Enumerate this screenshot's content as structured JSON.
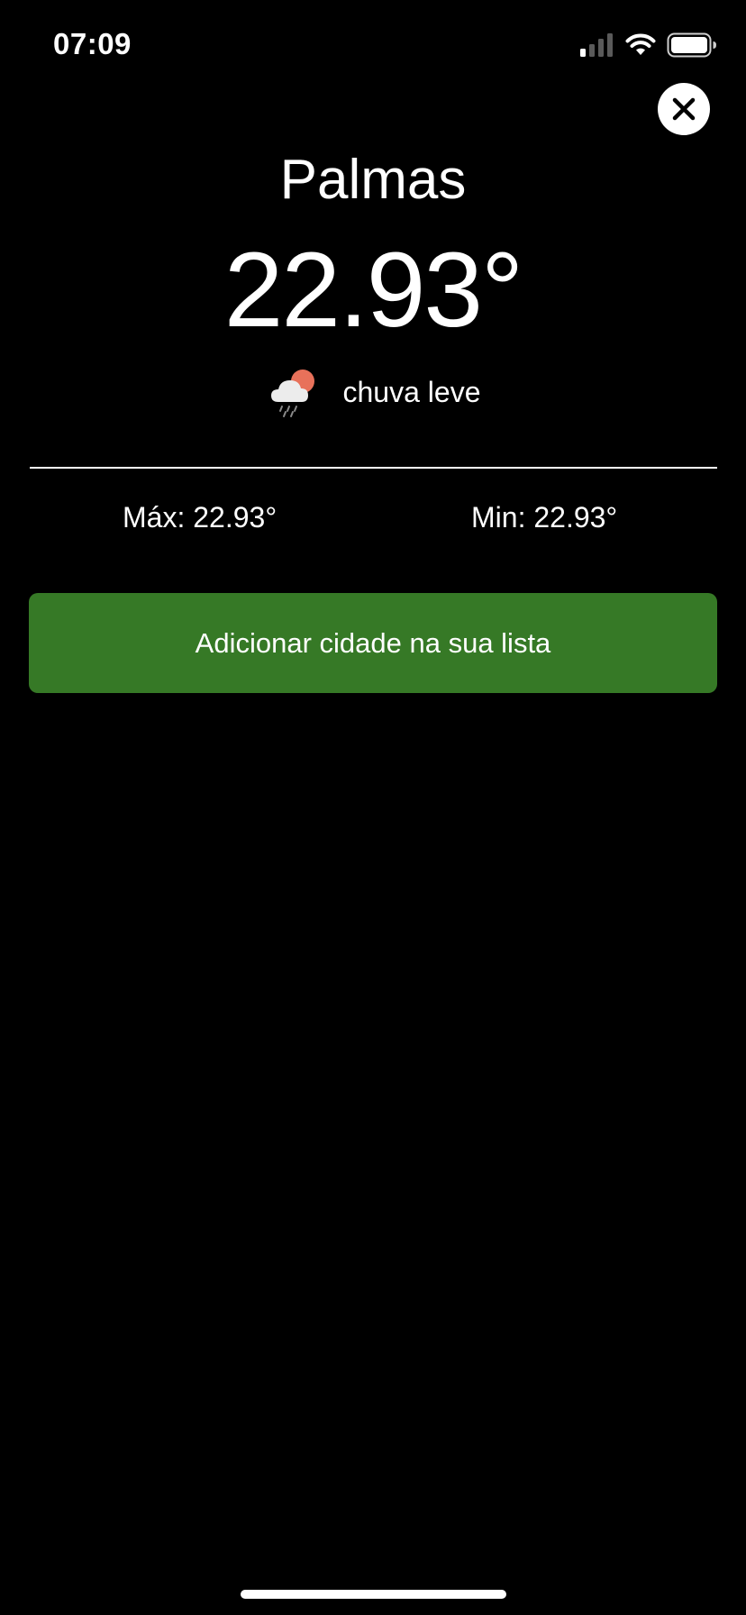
{
  "status_bar": {
    "time": "07:09"
  },
  "close_button": {
    "icon": "close-icon"
  },
  "weather": {
    "city": "Palmas",
    "temperature": "22.93°",
    "condition_icon": "cloud-sun-rain-icon",
    "condition": "chuva leve",
    "max": "Máx: 22.93°",
    "min": "Min: 22.93°"
  },
  "actions": {
    "add_city_label": "Adicionar cidade na sua lista"
  },
  "colors": {
    "background": "#000000",
    "text": "#ffffff",
    "button": "#367926",
    "sun": "#e8715a"
  }
}
